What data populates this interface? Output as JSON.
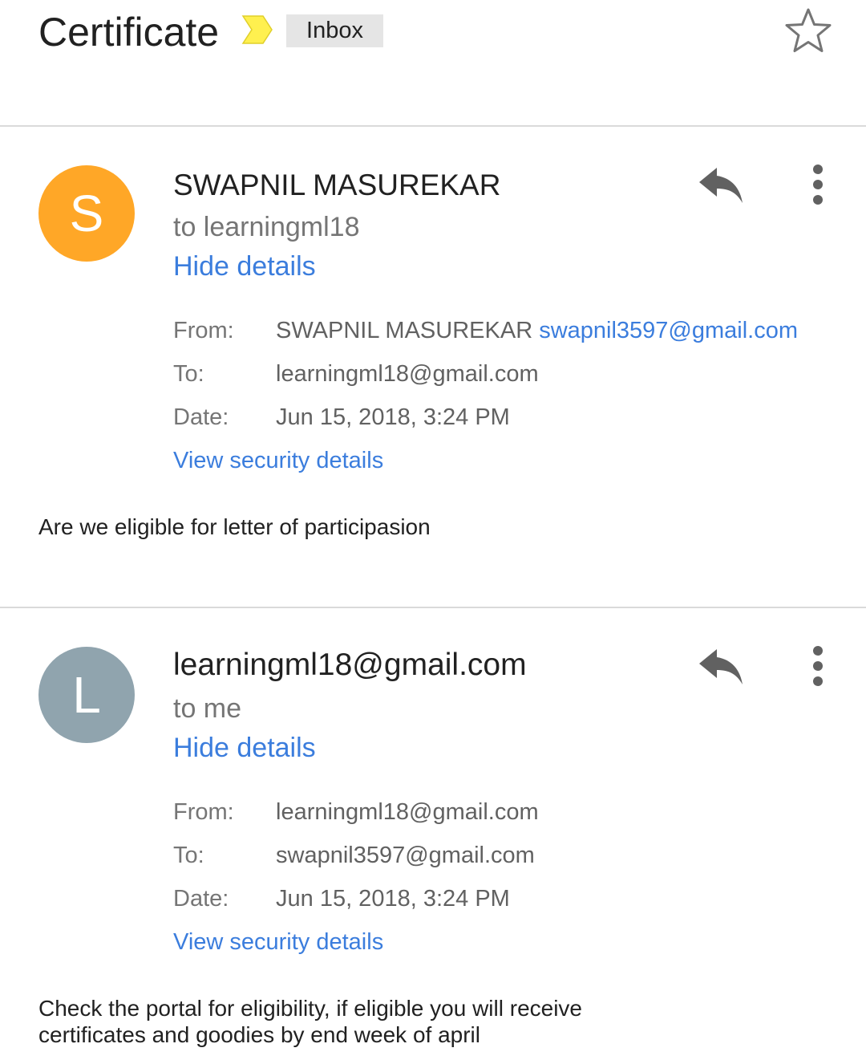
{
  "thread": {
    "subject": "Certificate",
    "label": "Inbox"
  },
  "icons": {
    "importance": "importance-marker-icon",
    "star": "star-outline-icon",
    "reply": "reply-icon",
    "more": "more-vert-icon"
  },
  "colors": {
    "link": "#3b7ddd",
    "avatar_s": "#ffa727",
    "avatar_l": "#90a4ae",
    "importance": "#fff04f"
  },
  "messages": [
    {
      "avatar_letter": "S",
      "sender": "SWAPNIL MASUREKAR",
      "recipient_summary": "to learningml18",
      "hide_details": "Hide details",
      "from_label": "From:",
      "from_name": "SWAPNIL MASUREKAR",
      "from_email": "swapnil3597@gmail.com",
      "to_label": "To:",
      "to_email": "learningml18@gmail.com",
      "date_label": "Date:",
      "date": "Jun 15, 2018, 3:24 PM",
      "security": "View security details",
      "body": "Are we eligible for letter of participasion"
    },
    {
      "avatar_letter": "L",
      "sender": "learningml18@gmail.com",
      "recipient_summary": "to me",
      "hide_details": "Hide details",
      "from_label": "From:",
      "from_email": "learningml18@gmail.com",
      "to_label": "To:",
      "to_email": "swapnil3597@gmail.com",
      "date_label": "Date:",
      "date": "Jun 15, 2018, 3:24 PM",
      "security": "View security details",
      "body_line1": "Check the portal for eligibility, if eligible you will receive",
      "body_line2": "certificates and goodies by end week of april"
    }
  ]
}
